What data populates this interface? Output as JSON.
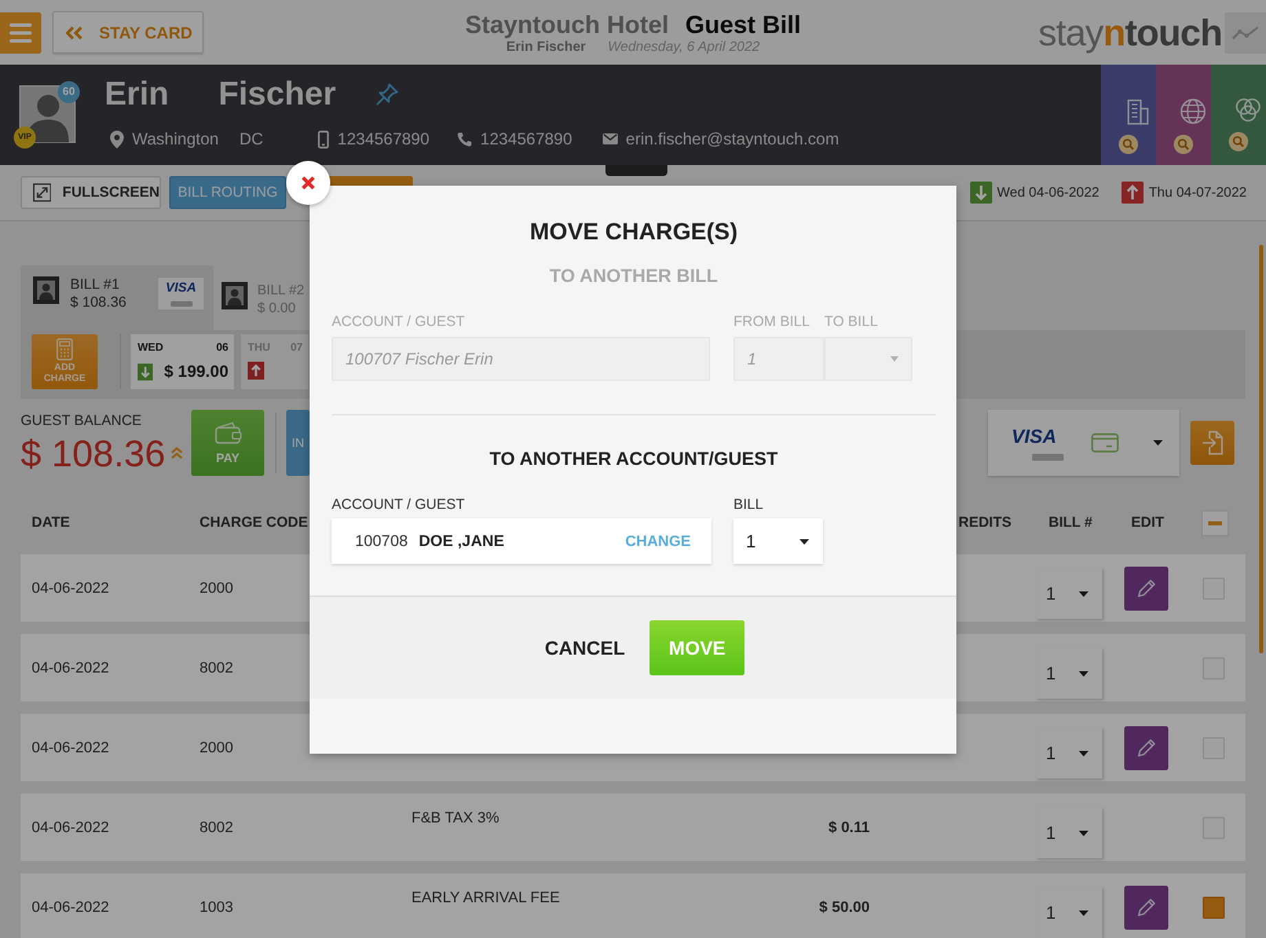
{
  "header": {
    "stay_card_button": "STAY CARD",
    "hotel_name": "Stayntouch Hotel",
    "page_title": "Guest Bill",
    "guest_name": "Erin Fischer",
    "date": "Wednesday, 6 April 2022",
    "logo": {
      "start": "stay",
      "accent": "n",
      "end": "touch"
    }
  },
  "guest": {
    "first_name": "Erin",
    "last_name": "Fischer",
    "points_badge": "60",
    "vip_badge": "VIP",
    "city": "Washington",
    "state": "DC",
    "mobile": "1234567890",
    "phone": "1234567890",
    "email": "erin.fischer@stayntouch.com"
  },
  "side_tabs": [
    {
      "kind": "building",
      "color": "#3a3c6a"
    },
    {
      "kind": "globe",
      "color": "#643355"
    },
    {
      "kind": "circles",
      "color": "#33583d"
    }
  ],
  "toolbar": {
    "buttons": [
      {
        "kind": "fullscreen",
        "label": "FULLSCREEN"
      },
      {
        "kind": "routing",
        "label": "BILL ROUTING"
      }
    ],
    "stay_dates": [
      {
        "kind": "arrival",
        "label": "Wed 04-06-2022"
      },
      {
        "kind": "departure",
        "label": "Thu 04-07-2022"
      }
    ]
  },
  "bills": [
    {
      "label": "BILL #1",
      "amount": "$ 108.36",
      "card_brand": "VISA",
      "selected": true
    },
    {
      "label": "BILL #2",
      "amount": "$ 0.00",
      "selected": false
    }
  ],
  "add_charge_button": "ADD CHARGE",
  "days": [
    {
      "weekday": "WED",
      "day": "06",
      "kind": "arrival",
      "amount": "$ 199.00",
      "selected": true
    },
    {
      "weekday": "THU",
      "day": "07",
      "kind": "departure",
      "selected": false
    }
  ],
  "balance": {
    "label": "GUEST BALANCE",
    "amount": "$ 108.36"
  },
  "actions": [
    {
      "kind": "pay",
      "label": "PAY"
    },
    {
      "kind": "other",
      "label": "IN"
    }
  ],
  "payment_method": {
    "card_brand": "VISA"
  },
  "table": {
    "columns": [
      "DATE",
      "CHARGE CODE",
      "REDITS",
      "BILL #",
      "EDIT"
    ],
    "select_all": {
      "indeterminate": true
    },
    "rows": [
      {
        "date": "04-06-2022",
        "code": "2000",
        "bill": "1",
        "editable": true,
        "checked": false
      },
      {
        "date": "04-06-2022",
        "code": "8002",
        "bill": "1",
        "editable": false,
        "checked": false
      },
      {
        "date": "04-06-2022",
        "code": "2000",
        "bill": "1",
        "editable": true,
        "checked": false
      },
      {
        "date": "04-06-2022",
        "code": "8002",
        "description": "F&B TAX 3%",
        "amount": "$ 0.11",
        "bill": "1",
        "editable": false,
        "checked": false
      },
      {
        "date": "04-06-2022",
        "code": "1003",
        "description": "EARLY ARRIVAL FEE",
        "amount": "$ 50.00",
        "bill": "1",
        "editable": true,
        "checked": true
      }
    ]
  },
  "modal": {
    "title": "MOVE CHARGE(S)",
    "to_bill": {
      "heading": "TO ANOTHER BILL",
      "disabled": true,
      "account_label": "ACCOUNT / GUEST",
      "account_value": "100707 Fischer Erin",
      "from_label": "FROM BILL",
      "from_value": "1",
      "to_label": "TO BILL"
    },
    "to_account": {
      "heading": "TO ANOTHER ACCOUNT/GUEST",
      "account_label": "ACCOUNT / GUEST",
      "account_number": "100708",
      "account_name": "DOE ,JANE",
      "change_link": "CHANGE",
      "bill_label": "BILL",
      "bill_value": "1"
    },
    "cancel_button": "CANCEL",
    "move_button": "MOVE"
  }
}
